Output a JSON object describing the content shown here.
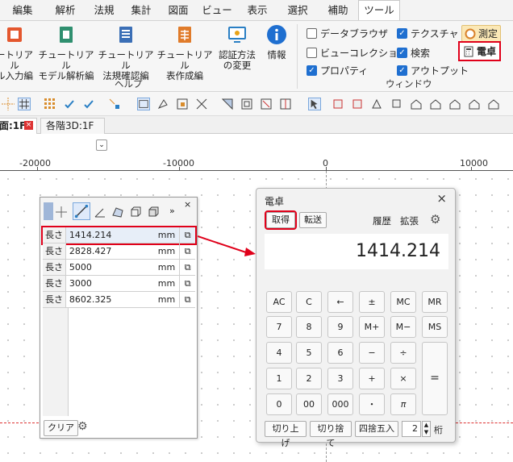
{
  "menus": [
    {
      "label": "編集"
    },
    {
      "label": "解析"
    },
    {
      "label": "法規"
    },
    {
      "label": "集計"
    },
    {
      "label": "図面"
    },
    {
      "label": "ビュー"
    },
    {
      "label": "表示"
    },
    {
      "label": "選択"
    },
    {
      "label": "補助"
    },
    {
      "label": "ツール",
      "active": true
    }
  ],
  "ribbon": {
    "buttons": [
      {
        "line1": "ートリアル",
        "line2": "ル入力編"
      },
      {
        "line1": "チュートリアル",
        "line2": "モデル解析編"
      },
      {
        "line1": "チュートリアル",
        "line2": "法規確認編"
      },
      {
        "line1": "チュートリアル",
        "line2": "表作成編"
      },
      {
        "line1": "認証方法",
        "line2": "の変更"
      },
      {
        "line1": "情報",
        "line2": ""
      }
    ],
    "help_group": "ヘルプ",
    "window_group": "ウィンドウ",
    "checks": [
      {
        "label": "データブラウザ",
        "checked": false
      },
      {
        "label": "ビューコレクション",
        "checked": false
      },
      {
        "label": "プロパティ",
        "checked": true
      },
      {
        "label": "テクスチャ",
        "checked": true
      },
      {
        "label": "検索",
        "checked": true
      },
      {
        "label": "アウトプット",
        "checked": true
      }
    ],
    "measure_label": "測定",
    "calculator_label": "電卓"
  },
  "tabs": [
    {
      "label": "面:1F"
    },
    {
      "label": "各階3D:1F"
    }
  ],
  "ruler": [
    "-20000",
    "-10000",
    "0",
    "10000"
  ],
  "measure_panel": {
    "rows": [
      {
        "type": "長さ",
        "value": "1414.214",
        "unit": "mm"
      },
      {
        "type": "長さ",
        "value": "2828.427",
        "unit": "mm"
      },
      {
        "type": "長さ",
        "value": "5000",
        "unit": "mm"
      },
      {
        "type": "長さ",
        "value": "3000",
        "unit": "mm"
      },
      {
        "type": "長さ",
        "value": "8602.325",
        "unit": "mm"
      }
    ],
    "clear": "クリア"
  },
  "calculator": {
    "title": "電卓",
    "get": "取得",
    "transfer": "転送",
    "history": "履歴",
    "expand": "拡張",
    "display": "1414.214",
    "keys": [
      [
        "AC",
        "C",
        "←",
        "±",
        "MC",
        "MR"
      ],
      [
        "7",
        "8",
        "9",
        "M+",
        "M−",
        "MS"
      ],
      [
        "4",
        "5",
        "6",
        "−",
        "÷",
        ""
      ],
      [
        "1",
        "2",
        "3",
        "+",
        "×",
        "="
      ],
      [
        "0",
        "00",
        "000",
        "・",
        "π",
        ""
      ]
    ],
    "round_up": "切り上げ",
    "round_down": "切り捨て",
    "round": "四捨五入",
    "digits": "2",
    "digits_unit": "桁"
  },
  "colors": {
    "highlight": "#e0001a",
    "accent": "#1f6fd0"
  }
}
